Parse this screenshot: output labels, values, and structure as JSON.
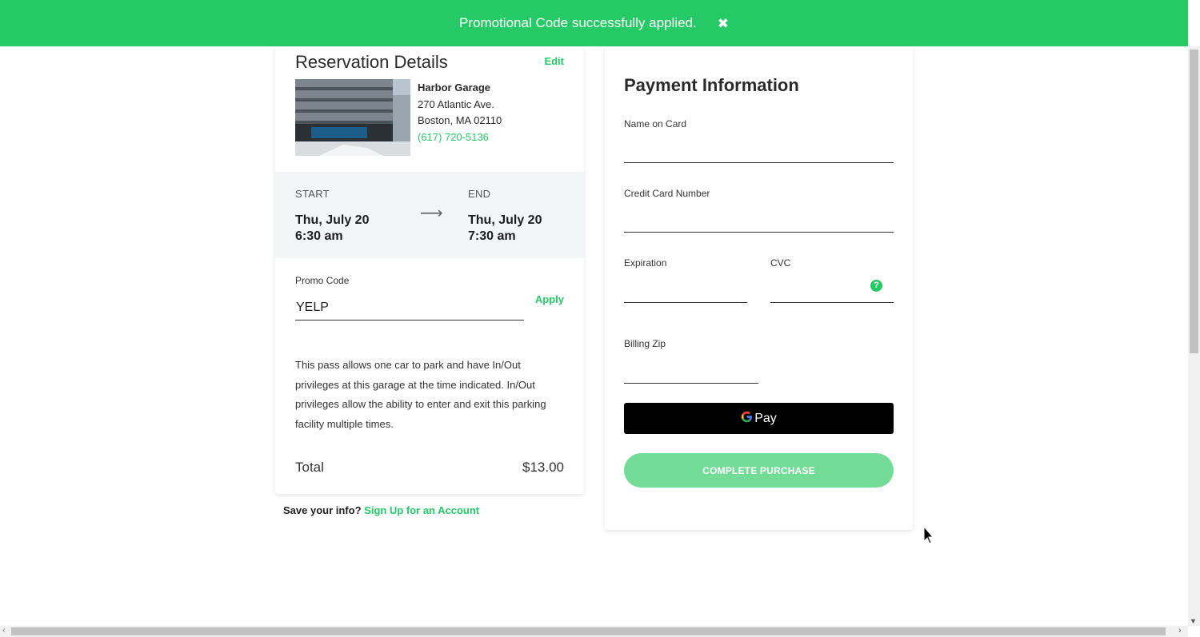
{
  "banner": {
    "message": "Promotional Code successfully applied.",
    "close_icon": "close-icon",
    "color": "#25c965"
  },
  "reservation": {
    "title": "Reservation Details",
    "edit_label": "Edit",
    "garage": {
      "name": "Harbor Garage",
      "address_line1": "270 Atlantic Ave.",
      "address_line2": "Boston, MA 02110",
      "phone": "(617) 720-5136"
    },
    "start": {
      "label": "START",
      "date": "Thu, July 20",
      "time": "6:30 am"
    },
    "end": {
      "label": "END",
      "date": "Thu, July 20",
      "time": "7:30 am"
    },
    "arrow": "⟶",
    "promo": {
      "label": "Promo Code",
      "value": "YELP",
      "apply_label": "Apply"
    },
    "description": "This pass allows one car to park and have In/Out privileges at this garage at the time indicated. In/Out privileges allow the ability to enter and exit this parking facility multiple times.",
    "total_label": "Total",
    "total_value": "$13.00"
  },
  "signup": {
    "prompt": "Save your info?",
    "link": "Sign Up for an Account"
  },
  "payment": {
    "title": "Payment Information",
    "name_label": "Name on Card",
    "card_label": "Credit Card Number",
    "expiration_label": "Expiration",
    "cvc_label": "CVC",
    "zip_label": "Billing Zip",
    "gpay_label": "Pay",
    "complete_label": "COMPLETE PURCHASE"
  },
  "colors": {
    "accent": "#25c965",
    "complete_button": "#72dc96",
    "gpay_button": "#000000",
    "times_bg": "#f3f6f7"
  }
}
